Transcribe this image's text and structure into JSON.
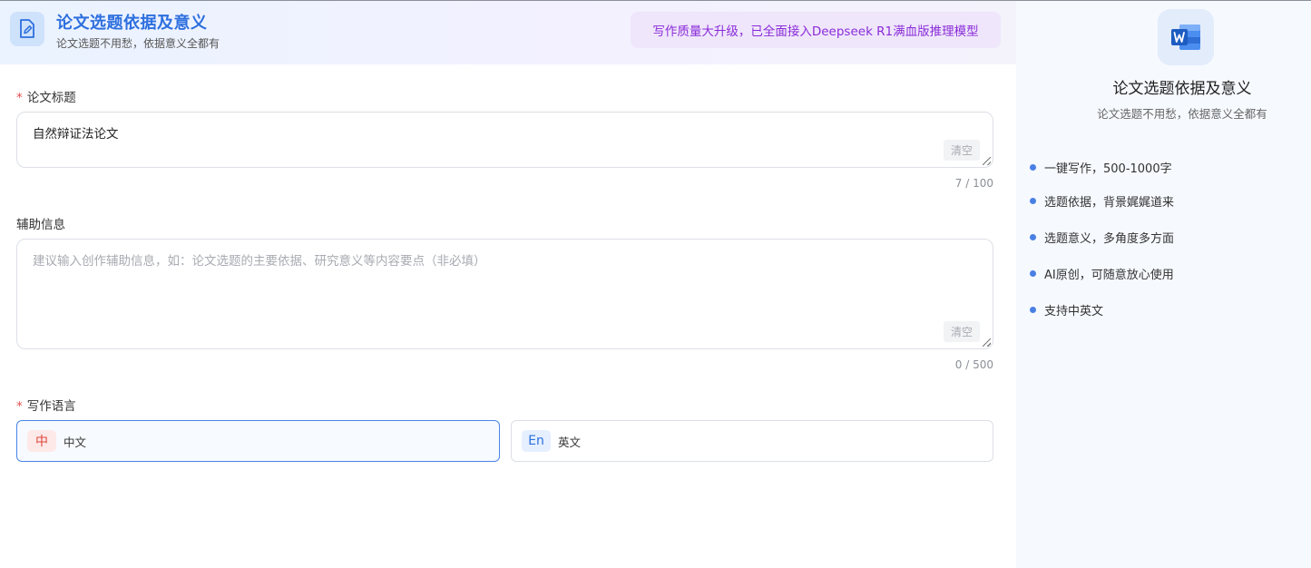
{
  "header": {
    "title": "论文选题依据及意义",
    "subtitle": "论文选题不用愁，依据意义全都有",
    "promo": "写作质量大升级，已全面接入Deepseek R1满血版推理模型",
    "icon": "edit-document-icon"
  },
  "form": {
    "title_field": {
      "label": "论文标题",
      "required_mark": "*",
      "value": "自然辩证法论文",
      "clear_label": "清空",
      "counter": "7 / 100"
    },
    "info_field": {
      "label": "辅助信息",
      "placeholder": "建议输入创作辅助信息，如：论文选题的主要依据、研究意义等内容要点（非必填）",
      "clear_label": "清空",
      "counter": "0 / 500"
    },
    "language": {
      "label": "写作语言",
      "required_mark": "*",
      "options": [
        {
          "badge": "中",
          "name": "中文",
          "selected": true
        },
        {
          "badge": "En",
          "name": "英文",
          "selected": false
        }
      ]
    }
  },
  "side": {
    "logo_icon": "word-document-icon",
    "title": "论文选题依据及意义",
    "subtitle": "论文选题不用愁，依据意义全都有",
    "features": [
      "一键写作，500-1000字",
      "选题依据，背景娓娓道来",
      "选题意义，多角度多方面",
      "AI原创，可随意放心使用",
      "支持中英文"
    ]
  },
  "colors": {
    "accent": "#2d6fde",
    "promo_text": "#8a2bd8",
    "required": "#e34d4d",
    "bullet": "#4a80e4"
  }
}
